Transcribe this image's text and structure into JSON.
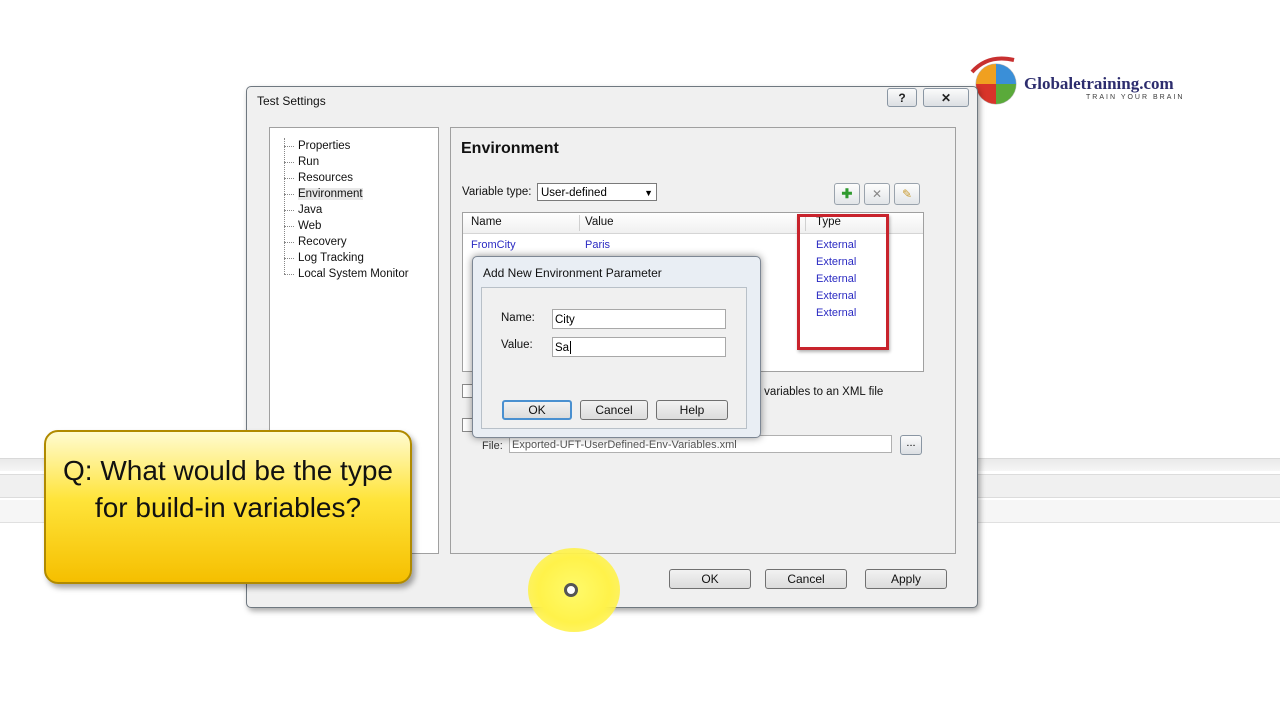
{
  "logo": {
    "name": "Globaletraining.com",
    "tagline": "TRAIN YOUR BRAIN"
  },
  "dialog": {
    "title": "Test Settings",
    "help_label": "?",
    "close_label": "✕",
    "tree": [
      "Properties",
      "Run",
      "Resources",
      "Environment",
      "Java",
      "Web",
      "Recovery",
      "Log Tracking",
      "Local System Monitor"
    ],
    "selected": "Environment"
  },
  "environment": {
    "heading": "Environment",
    "variable_type_label": "Variable type:",
    "variable_type_value": "User-defined",
    "columns": [
      "Name",
      "Value",
      "Type"
    ],
    "rows": [
      {
        "name": "FromCity",
        "value": "Paris",
        "type": "External"
      },
      {
        "name": "",
        "value": "",
        "type": "External"
      },
      {
        "name": "",
        "value": "",
        "type": "External"
      },
      {
        "name": "",
        "value": "",
        "type": "External"
      },
      {
        "name": "",
        "value": "",
        "type": "External"
      }
    ],
    "export_text": "ent variables to an XML file",
    "file_label": "File:",
    "file_value": "Exported-UFT-UserDefined-Env-Variables.xml",
    "browse_label": "..."
  },
  "buttons": {
    "ok": "OK",
    "cancel": "Cancel",
    "apply": "Apply"
  },
  "add_param_dialog": {
    "title": "Add New Environment Parameter",
    "name_label": "Name:",
    "name_value": "City",
    "value_label": "Value:",
    "value_value": "Sa",
    "ok": "OK",
    "cancel": "Cancel",
    "help": "Help"
  },
  "callout": {
    "text": "Q: What would be the type for build-in variables?"
  }
}
